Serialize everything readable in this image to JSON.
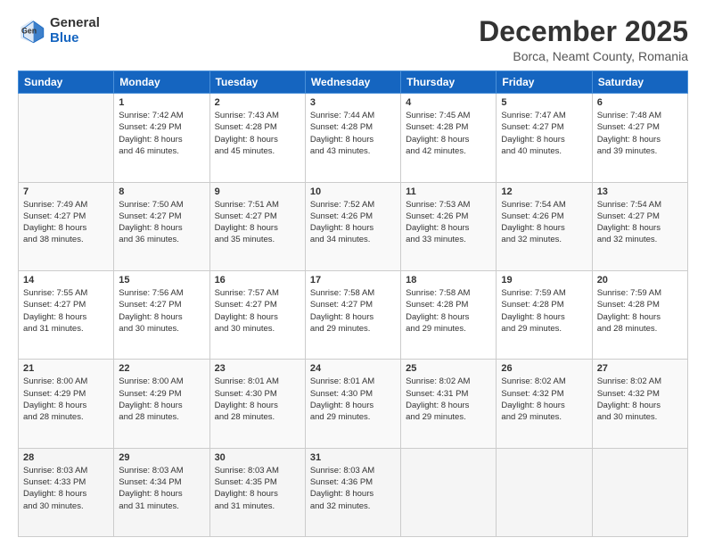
{
  "header": {
    "logo": {
      "general": "General",
      "blue": "Blue"
    },
    "title": "December 2025",
    "subtitle": "Borca, Neamt County, Romania"
  },
  "calendar": {
    "days_of_week": [
      "Sunday",
      "Monday",
      "Tuesday",
      "Wednesday",
      "Thursday",
      "Friday",
      "Saturday"
    ],
    "weeks": [
      [
        {
          "day": "",
          "info": ""
        },
        {
          "day": "1",
          "info": "Sunrise: 7:42 AM\nSunset: 4:29 PM\nDaylight: 8 hours\nand 46 minutes."
        },
        {
          "day": "2",
          "info": "Sunrise: 7:43 AM\nSunset: 4:28 PM\nDaylight: 8 hours\nand 45 minutes."
        },
        {
          "day": "3",
          "info": "Sunrise: 7:44 AM\nSunset: 4:28 PM\nDaylight: 8 hours\nand 43 minutes."
        },
        {
          "day": "4",
          "info": "Sunrise: 7:45 AM\nSunset: 4:28 PM\nDaylight: 8 hours\nand 42 minutes."
        },
        {
          "day": "5",
          "info": "Sunrise: 7:47 AM\nSunset: 4:27 PM\nDaylight: 8 hours\nand 40 minutes."
        },
        {
          "day": "6",
          "info": "Sunrise: 7:48 AM\nSunset: 4:27 PM\nDaylight: 8 hours\nand 39 minutes."
        }
      ],
      [
        {
          "day": "7",
          "info": "Sunrise: 7:49 AM\nSunset: 4:27 PM\nDaylight: 8 hours\nand 38 minutes."
        },
        {
          "day": "8",
          "info": "Sunrise: 7:50 AM\nSunset: 4:27 PM\nDaylight: 8 hours\nand 36 minutes."
        },
        {
          "day": "9",
          "info": "Sunrise: 7:51 AM\nSunset: 4:27 PM\nDaylight: 8 hours\nand 35 minutes."
        },
        {
          "day": "10",
          "info": "Sunrise: 7:52 AM\nSunset: 4:26 PM\nDaylight: 8 hours\nand 34 minutes."
        },
        {
          "day": "11",
          "info": "Sunrise: 7:53 AM\nSunset: 4:26 PM\nDaylight: 8 hours\nand 33 minutes."
        },
        {
          "day": "12",
          "info": "Sunrise: 7:54 AM\nSunset: 4:26 PM\nDaylight: 8 hours\nand 32 minutes."
        },
        {
          "day": "13",
          "info": "Sunrise: 7:54 AM\nSunset: 4:27 PM\nDaylight: 8 hours\nand 32 minutes."
        }
      ],
      [
        {
          "day": "14",
          "info": "Sunrise: 7:55 AM\nSunset: 4:27 PM\nDaylight: 8 hours\nand 31 minutes."
        },
        {
          "day": "15",
          "info": "Sunrise: 7:56 AM\nSunset: 4:27 PM\nDaylight: 8 hours\nand 30 minutes."
        },
        {
          "day": "16",
          "info": "Sunrise: 7:57 AM\nSunset: 4:27 PM\nDaylight: 8 hours\nand 30 minutes."
        },
        {
          "day": "17",
          "info": "Sunrise: 7:58 AM\nSunset: 4:27 PM\nDaylight: 8 hours\nand 29 minutes."
        },
        {
          "day": "18",
          "info": "Sunrise: 7:58 AM\nSunset: 4:28 PM\nDaylight: 8 hours\nand 29 minutes."
        },
        {
          "day": "19",
          "info": "Sunrise: 7:59 AM\nSunset: 4:28 PM\nDaylight: 8 hours\nand 29 minutes."
        },
        {
          "day": "20",
          "info": "Sunrise: 7:59 AM\nSunset: 4:28 PM\nDaylight: 8 hours\nand 28 minutes."
        }
      ],
      [
        {
          "day": "21",
          "info": "Sunrise: 8:00 AM\nSunset: 4:29 PM\nDaylight: 8 hours\nand 28 minutes."
        },
        {
          "day": "22",
          "info": "Sunrise: 8:00 AM\nSunset: 4:29 PM\nDaylight: 8 hours\nand 28 minutes."
        },
        {
          "day": "23",
          "info": "Sunrise: 8:01 AM\nSunset: 4:30 PM\nDaylight: 8 hours\nand 28 minutes."
        },
        {
          "day": "24",
          "info": "Sunrise: 8:01 AM\nSunset: 4:30 PM\nDaylight: 8 hours\nand 29 minutes."
        },
        {
          "day": "25",
          "info": "Sunrise: 8:02 AM\nSunset: 4:31 PM\nDaylight: 8 hours\nand 29 minutes."
        },
        {
          "day": "26",
          "info": "Sunrise: 8:02 AM\nSunset: 4:32 PM\nDaylight: 8 hours\nand 29 minutes."
        },
        {
          "day": "27",
          "info": "Sunrise: 8:02 AM\nSunset: 4:32 PM\nDaylight: 8 hours\nand 30 minutes."
        }
      ],
      [
        {
          "day": "28",
          "info": "Sunrise: 8:03 AM\nSunset: 4:33 PM\nDaylight: 8 hours\nand 30 minutes."
        },
        {
          "day": "29",
          "info": "Sunrise: 8:03 AM\nSunset: 4:34 PM\nDaylight: 8 hours\nand 31 minutes."
        },
        {
          "day": "30",
          "info": "Sunrise: 8:03 AM\nSunset: 4:35 PM\nDaylight: 8 hours\nand 31 minutes."
        },
        {
          "day": "31",
          "info": "Sunrise: 8:03 AM\nSunset: 4:36 PM\nDaylight: 8 hours\nand 32 minutes."
        },
        {
          "day": "",
          "info": ""
        },
        {
          "day": "",
          "info": ""
        },
        {
          "day": "",
          "info": ""
        }
      ]
    ]
  }
}
